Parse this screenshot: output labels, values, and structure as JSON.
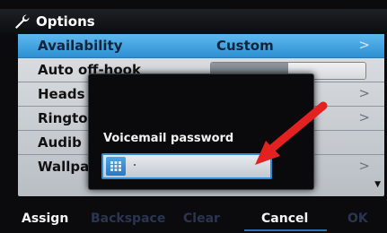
{
  "title": "Options",
  "title_icon": "wrench-icon",
  "rows": [
    {
      "label": "Availability",
      "value": "Custom",
      "chevron": ">"
    },
    {
      "label": "Auto off-hook",
      "toggle_left": "",
      "toggle_right": ""
    },
    {
      "label": "Heads",
      "chevron": ">"
    },
    {
      "label": "Ringto",
      "chevron": ">"
    },
    {
      "label": "Audib"
    },
    {
      "label": "Wallpa",
      "chevron": ">"
    }
  ],
  "dialog": {
    "label": "Voicemail password",
    "value": "",
    "keyboard_icon": "keypad-icon"
  },
  "softkeys": {
    "assign": "Assign",
    "backspace": "Backspace",
    "clear": "Clear",
    "cancel": "Cancel",
    "ok": "OK"
  },
  "colors": {
    "selection": "#3fa0e0",
    "annotation_arrow": "#e32121"
  }
}
